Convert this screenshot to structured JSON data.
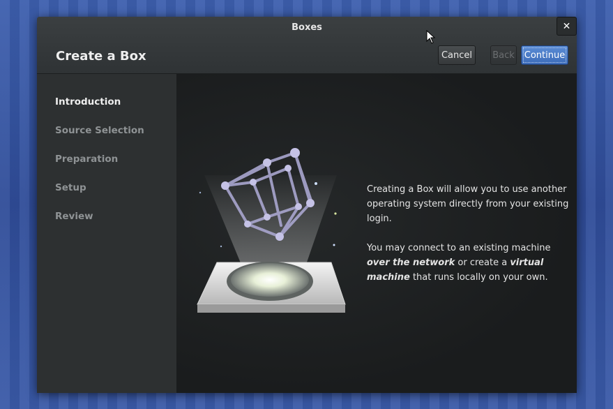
{
  "window": {
    "title": "Boxes",
    "close_glyph": "✕"
  },
  "header": {
    "page_title": "Create a Box",
    "cancel_label": "Cancel",
    "back_label": "Back",
    "continue_label": "Continue"
  },
  "sidebar": {
    "steps": [
      {
        "label": "Introduction",
        "active": true
      },
      {
        "label": "Source Selection",
        "active": false
      },
      {
        "label": "Preparation",
        "active": false
      },
      {
        "label": "Setup",
        "active": false
      },
      {
        "label": "Review",
        "active": false
      }
    ]
  },
  "content": {
    "paragraph1": "Creating a Box will allow you to use another operating system directly from your existing login.",
    "p2_a": "You may connect to an existing machine ",
    "p2_b": "over the network",
    "p2_c": " or create a ",
    "p2_d": "virtual machine",
    "p2_e": " that runs locally on your own."
  },
  "icons": {
    "illustration": "hypercube-box-icon",
    "cursor": "mouse-pointer-icon"
  },
  "colors": {
    "accent": "#4a7bc8",
    "desktop": "#3a58a6"
  }
}
